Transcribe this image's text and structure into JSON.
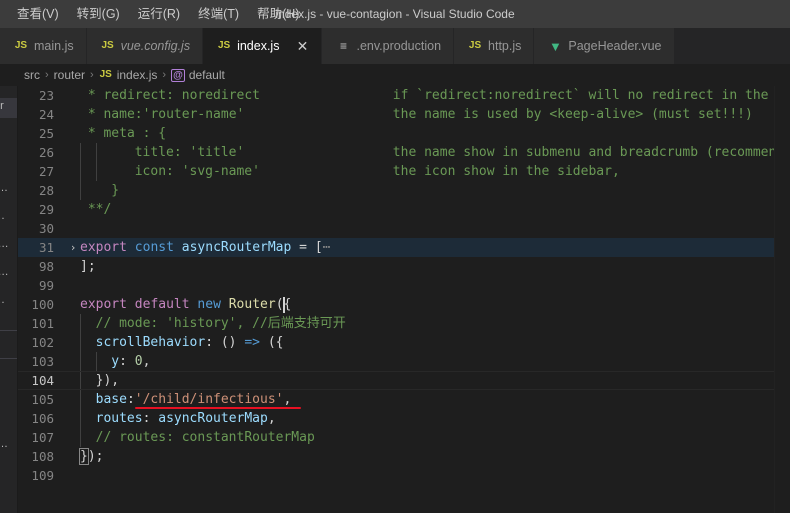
{
  "window": {
    "title": "index.js - vue-contagion - Visual Studio Code"
  },
  "menubar": {
    "items": [
      {
        "label": "查看(V)",
        "name": "menu-view"
      },
      {
        "label": "转到(G)",
        "name": "menu-goto"
      },
      {
        "label": "运行(R)",
        "name": "menu-run"
      },
      {
        "label": "终端(T)",
        "name": "menu-terminal"
      },
      {
        "label": "帮助(H)",
        "name": "menu-help"
      }
    ]
  },
  "tabs": [
    {
      "label": "main.js",
      "icon": "js-file-icon",
      "icon_text": "JS",
      "active": false,
      "preview": false
    },
    {
      "label": "vue.config.js",
      "icon": "js-file-icon",
      "icon_text": "JS",
      "active": false,
      "preview": true
    },
    {
      "label": "index.js",
      "icon": "js-file-icon",
      "icon_text": "JS",
      "active": true,
      "preview": false,
      "close_glyph": "✕"
    },
    {
      "label": ".env.production",
      "icon": "env-file-icon",
      "icon_text": "≡",
      "active": false,
      "preview": false
    },
    {
      "label": "http.js",
      "icon": "js-file-icon",
      "icon_text": "JS",
      "active": false,
      "preview": false
    },
    {
      "label": "PageHeader.vue",
      "icon": "vue-file-icon",
      "icon_text": "▼",
      "active": false,
      "preview": false
    }
  ],
  "breadcrumb": {
    "separator": "›",
    "items": [
      {
        "label": "src",
        "type": "folder"
      },
      {
        "label": "router",
        "type": "folder"
      },
      {
        "label": "index.js",
        "type": "file",
        "icon_text": "JS"
      },
      {
        "label": "default",
        "type": "symbol",
        "icon_text": "@"
      }
    ]
  },
  "side_peek": {
    "fragments": [
      "er",
      "t…",
      "…",
      ")…",
      ")…",
      "…",
      "t…"
    ]
  },
  "editor": {
    "annotation": {
      "color": "#e81123",
      "target_line": 105,
      "target_text": "'/child/infectious',"
    },
    "lines": [
      {
        "num": "23",
        "indent": 0,
        "state": "normal",
        "left": [
          {
            "t": " * redirect: noredirect",
            "c": "c-comment"
          }
        ],
        "right": {
          "text": "if `redirect:noredirect` will no redirect in the breadcrumb",
          "c": "c-comment"
        }
      },
      {
        "num": "24",
        "indent": 0,
        "state": "normal",
        "left": [
          {
            "t": " * name:'router-name'",
            "c": "c-comment"
          }
        ],
        "right": {
          "text": "the name is used by <keep-alive> (must set!!!)",
          "c": "c-comment"
        }
      },
      {
        "num": "25",
        "indent": 0,
        "state": "normal",
        "left": [
          {
            "t": " * meta : {",
            "c": "c-comment"
          }
        ],
        "right": {
          "text": "",
          "c": "c-comment"
        }
      },
      {
        "num": "26",
        "indent": 2,
        "state": "normal",
        "left": [
          {
            "t": "   title: 'title'",
            "c": "c-comment"
          }
        ],
        "right": {
          "text": "the name show in submenu and breadcrumb (recommend set)",
          "c": "c-comment"
        }
      },
      {
        "num": "27",
        "indent": 2,
        "state": "normal",
        "left": [
          {
            "t": "   icon: 'svg-name'",
            "c": "c-comment"
          }
        ],
        "right": {
          "text": "the icon show in the sidebar,",
          "c": "c-comment"
        }
      },
      {
        "num": "28",
        "indent": 1,
        "state": "normal",
        "left": [
          {
            "t": "  }",
            "c": "c-comment"
          }
        ],
        "right": {
          "text": "",
          "c": "c-comment"
        }
      },
      {
        "num": "29",
        "indent": 0,
        "state": "normal",
        "left": [
          {
            "t": " **/",
            "c": "c-comment"
          }
        ],
        "right": {
          "text": "",
          "c": "c-comment"
        }
      },
      {
        "num": "30",
        "indent": 0,
        "state": "normal",
        "left": [
          {
            "t": "",
            "c": "c-plain"
          }
        ],
        "right": {
          "text": "",
          "c": "c-plain"
        }
      },
      {
        "num": "31",
        "indent": 0,
        "state": "folded",
        "fold_glyph": "›",
        "left": [
          {
            "t": "export",
            "c": "c-keyword"
          },
          {
            "t": " ",
            "c": "c-plain"
          },
          {
            "t": "const",
            "c": "c-kw2"
          },
          {
            "t": " ",
            "c": "c-plain"
          },
          {
            "t": "asyncRouterMap",
            "c": "c-var"
          },
          {
            "t": " = [",
            "c": "c-plain"
          },
          {
            "t": "⋯",
            "c": "c-ellipsis"
          }
        ],
        "right": {
          "text": "",
          "c": "c-plain"
        }
      },
      {
        "num": "98",
        "indent": 0,
        "state": "normal",
        "left": [
          {
            "t": "];",
            "c": "c-plain"
          }
        ],
        "right": {
          "text": "",
          "c": "c-plain"
        }
      },
      {
        "num": "99",
        "indent": 0,
        "state": "normal",
        "left": [
          {
            "t": "",
            "c": "c-plain"
          }
        ],
        "right": {
          "text": "",
          "c": "c-plain"
        }
      },
      {
        "num": "100",
        "indent": 0,
        "state": "normal",
        "left": [
          {
            "t": "export",
            "c": "c-keyword"
          },
          {
            "t": " ",
            "c": "c-plain"
          },
          {
            "t": "default",
            "c": "c-keyword"
          },
          {
            "t": " ",
            "c": "c-plain"
          },
          {
            "t": "new",
            "c": "c-kw2"
          },
          {
            "t": " ",
            "c": "c-plain"
          },
          {
            "t": "Router",
            "c": "c-fn"
          },
          {
            "t": "(",
            "c": "c-plain"
          },
          {
            "t": "CARET",
            "c": "caret"
          },
          {
            "t": "{",
            "c": "c-plain"
          }
        ],
        "right": {
          "text": "",
          "c": "c-plain"
        }
      },
      {
        "num": "101",
        "indent": 1,
        "state": "normal",
        "left": [
          {
            "t": "// mode: 'history', //后端支持可开",
            "c": "c-comment"
          }
        ],
        "right": {
          "text": "",
          "c": "c-plain"
        }
      },
      {
        "num": "102",
        "indent": 1,
        "state": "normal",
        "left": [
          {
            "t": "scrollBehavior",
            "c": "c-var"
          },
          {
            "t": ": () ",
            "c": "c-plain"
          },
          {
            "t": "=>",
            "c": "c-arrow"
          },
          {
            "t": " ({",
            "c": "c-plain"
          }
        ],
        "right": {
          "text": "",
          "c": "c-plain"
        }
      },
      {
        "num": "103",
        "indent": 2,
        "state": "normal",
        "left": [
          {
            "t": "y",
            "c": "c-var"
          },
          {
            "t": ": ",
            "c": "c-plain"
          },
          {
            "t": "0",
            "c": "c-num"
          },
          {
            "t": ",",
            "c": "c-plain"
          }
        ],
        "right": {
          "text": "",
          "c": "c-plain"
        }
      },
      {
        "num": "104",
        "indent": 1,
        "state": "current",
        "left": [
          {
            "t": "}),",
            "c": "c-plain"
          }
        ],
        "right": {
          "text": "",
          "c": "c-plain"
        }
      },
      {
        "num": "105",
        "indent": 1,
        "state": "normal",
        "left": [
          {
            "t": "base",
            "c": "c-var"
          },
          {
            "t": ":",
            "c": "c-plain"
          },
          {
            "t": "'/child/infectious'",
            "c": "c-string"
          },
          {
            "t": ",",
            "c": "c-plain"
          }
        ],
        "right": {
          "text": "",
          "c": "c-plain"
        }
      },
      {
        "num": "106",
        "indent": 1,
        "state": "normal",
        "left": [
          {
            "t": "routes",
            "c": "c-var"
          },
          {
            "t": ": ",
            "c": "c-plain"
          },
          {
            "t": "asyncRouterMap",
            "c": "c-var"
          },
          {
            "t": ",",
            "c": "c-plain"
          }
        ],
        "right": {
          "text": "",
          "c": "c-plain"
        }
      },
      {
        "num": "107",
        "indent": 1,
        "state": "normal",
        "left": [
          {
            "t": "// routes: constantRouterMap",
            "c": "c-comment"
          }
        ],
        "right": {
          "text": "",
          "c": "c-plain"
        }
      },
      {
        "num": "108",
        "indent": 0,
        "state": "normal",
        "left": [
          {
            "t": "}",
            "c": "c-plain bracket-box"
          },
          {
            "t": ");",
            "c": "c-plain"
          }
        ],
        "right": {
          "text": "",
          "c": "c-plain"
        }
      },
      {
        "num": "109",
        "indent": 0,
        "state": "normal",
        "left": [
          {
            "t": "",
            "c": "c-plain"
          }
        ],
        "right": {
          "text": "",
          "c": "c-plain"
        }
      }
    ]
  }
}
